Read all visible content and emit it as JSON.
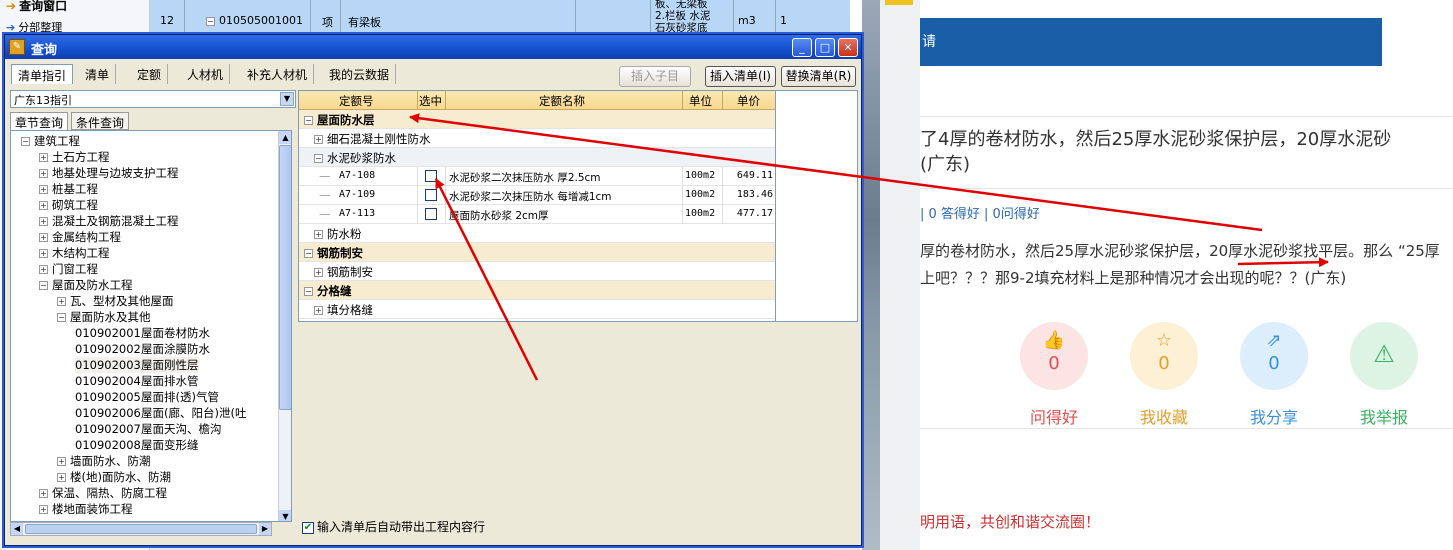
{
  "bg_sheet": {
    "nav": [
      {
        "label": "查询窗口"
      },
      {
        "label": "分部整理"
      }
    ],
    "row": {
      "num": "12",
      "code": "010505001001",
      "type": "项",
      "name": "有梁板",
      "desc_line1": "板、无梁板",
      "desc_line2": "2.栏板 水泥",
      "desc_line3": "石灰砂浆底",
      "unit": "m3",
      "qty": "1"
    }
  },
  "dialog": {
    "title": "查询",
    "window_buttons": {
      "minimize": "_",
      "maximize": "□",
      "close": "✕"
    },
    "tabs": [
      {
        "label": "清单指引",
        "active": true
      },
      {
        "label": "清单",
        "active": false
      },
      {
        "label": "定额",
        "active": false
      },
      {
        "label": "人材机",
        "active": false
      },
      {
        "label": "补充人材机",
        "active": false
      },
      {
        "label": "我的云数据",
        "active": false
      }
    ],
    "buttons": {
      "insert_child": "插入子目",
      "insert_list": "插入清单(I)",
      "replace_list": "替换清单(R)"
    },
    "guide_select": "广东13指引",
    "subtabs": [
      {
        "label": "章节查询",
        "active": true
      },
      {
        "label": "条件查询",
        "active": false
      }
    ],
    "tree": [
      {
        "pm": "−",
        "label": "建筑工程",
        "depth": 0
      },
      {
        "pm": "+",
        "label": "土石方工程",
        "depth": 1
      },
      {
        "pm": "+",
        "label": "地基处理与边坡支护工程",
        "depth": 1
      },
      {
        "pm": "+",
        "label": "桩基工程",
        "depth": 1
      },
      {
        "pm": "+",
        "label": "砌筑工程",
        "depth": 1
      },
      {
        "pm": "+",
        "label": "混凝土及钢筋混凝土工程",
        "depth": 1
      },
      {
        "pm": "+",
        "label": "金属结构工程",
        "depth": 1
      },
      {
        "pm": "+",
        "label": "木结构工程",
        "depth": 1
      },
      {
        "pm": "+",
        "label": "门窗工程",
        "depth": 1
      },
      {
        "pm": "−",
        "label": "屋面及防水工程",
        "depth": 1
      },
      {
        "pm": "+",
        "label": "瓦、型材及其他屋面",
        "depth": 2
      },
      {
        "pm": "−",
        "label": "屋面防水及其他",
        "depth": 2
      },
      {
        "code": "010902001",
        "label": "屋面卷材防水",
        "depth": 3
      },
      {
        "code": "010902002",
        "label": "屋面涂膜防水",
        "depth": 3
      },
      {
        "code": "010902003",
        "label": "屋面刚性层",
        "depth": 3,
        "selected": true
      },
      {
        "code": "010902004",
        "label": "屋面排水管",
        "depth": 3
      },
      {
        "code": "010902005",
        "label": "屋面排(透)气管",
        "depth": 3
      },
      {
        "code": "010902006",
        "label": "屋面(廊、阳台)泄(吐",
        "depth": 3
      },
      {
        "code": "010902007",
        "label": "屋面天沟、檐沟",
        "depth": 3
      },
      {
        "code": "010902008",
        "label": "屋面变形缝",
        "depth": 3
      },
      {
        "pm": "+",
        "label": "墙面防水、防潮",
        "depth": 2
      },
      {
        "pm": "+",
        "label": "楼(地)面防水、防潮",
        "depth": 2
      },
      {
        "pm": "+",
        "label": "保温、隔热、防腐工程",
        "depth": 1
      },
      {
        "pm": "+",
        "label": "楼地面装饰工程",
        "depth": 1
      }
    ],
    "grid": {
      "headers": {
        "code": "定额号",
        "selected": "选中",
        "name": "定额名称",
        "unit": "单位",
        "price": "单价"
      },
      "rows": [
        {
          "kind": "cat",
          "pm": "−",
          "label": "屋面防水层"
        },
        {
          "kind": "sub",
          "pm": "+",
          "label": "细石混凝土刚性防水"
        },
        {
          "kind": "sub2",
          "pm": "−",
          "label": "水泥砂浆防水"
        },
        {
          "kind": "item",
          "code": "A7-108",
          "name": "水泥砂浆二次抹压防水 厚2.5cm",
          "unit": "100m2",
          "price": "649.11"
        },
        {
          "kind": "item",
          "code": "A7-109",
          "name": "水泥砂浆二次抹压防水 每增减1cm",
          "unit": "100m2",
          "price": "183.46"
        },
        {
          "kind": "item",
          "code": "A7-113",
          "name": "屋面防水砂浆 2cm厚",
          "unit": "100m2",
          "price": "477.17"
        },
        {
          "kind": "sub",
          "pm": "+",
          "label": "防水粉"
        },
        {
          "kind": "cat",
          "pm": "−",
          "label": "钢筋制安"
        },
        {
          "kind": "sub",
          "pm": "+",
          "label": "钢筋制安"
        },
        {
          "kind": "cat",
          "pm": "−",
          "label": "分格缝"
        },
        {
          "kind": "sub",
          "pm": "+",
          "label": "填分格缝"
        }
      ]
    },
    "auto_option": "输入清单后自动带出工程内容行"
  },
  "web": {
    "banner": "请",
    "title_line1": "了4厚的卷材防水，然后25厚水泥砂浆保护层，20厚水泥砂",
    "title_line2": "(广东)",
    "meta": "| 0 答得好 | 0问得好",
    "body_line1": "厚的卷材防水，然后25厚水泥砂浆保护层，20厚水泥砂浆找平层。那么 “25厚",
    "body_line2": "上吧？？？那9-2填充材料上是那种情况才会出现的呢？？(广东)",
    "actions": [
      {
        "icon": "👍",
        "count": "0",
        "label": "问得好",
        "bg": "#fde4e4",
        "color": "#e05050"
      },
      {
        "icon": "☆",
        "count": "0",
        "label": "我收藏",
        "bg": "#fdf0d4",
        "color": "#e0a030"
      },
      {
        "icon": "⇗",
        "count": "0",
        "label": "我分享",
        "bg": "#dceefc",
        "color": "#3a90e0"
      },
      {
        "icon": "⚠",
        "count": "",
        "label": "我举报",
        "bg": "#ddf4e4",
        "color": "#3ab060"
      }
    ],
    "footer": "明用语，共创和谐交流圈！"
  },
  "annotation_color": "#e00000"
}
